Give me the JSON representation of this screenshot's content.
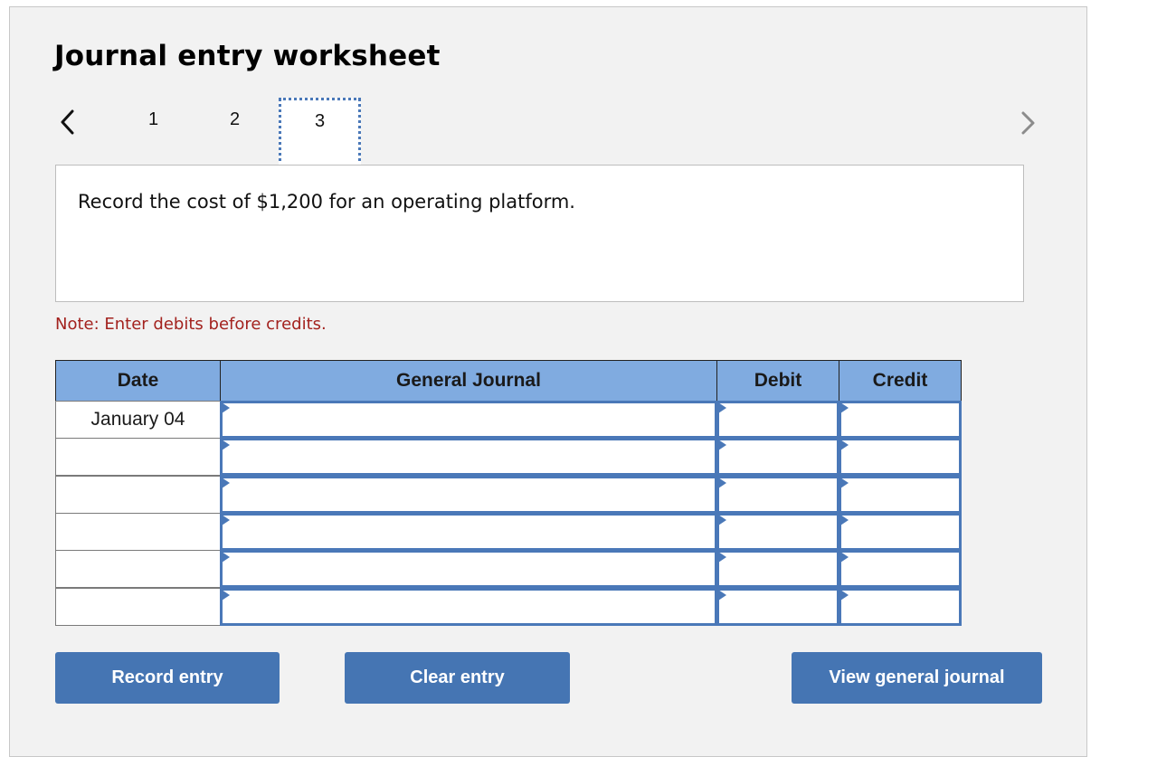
{
  "worksheet": {
    "title": "Journal entry worksheet",
    "nav": {
      "prev_icon": "chevron-left-icon",
      "next_icon": "chevron-right-icon",
      "steps": [
        "1",
        "2",
        "3"
      ],
      "active_step": "3"
    },
    "prompt": "Record the cost of $1,200 for an operating platform.",
    "note": "Note: Enter debits before credits."
  },
  "journal": {
    "headers": {
      "date": "Date",
      "general_journal": "General Journal",
      "debit": "Debit",
      "credit": "Credit"
    },
    "rows": [
      {
        "date": "January 04",
        "account": "",
        "debit": "",
        "credit": ""
      },
      {
        "date": "",
        "account": "",
        "debit": "",
        "credit": ""
      },
      {
        "date": "",
        "account": "",
        "debit": "",
        "credit": ""
      },
      {
        "date": "",
        "account": "",
        "debit": "",
        "credit": ""
      },
      {
        "date": "",
        "account": "",
        "debit": "",
        "credit": ""
      },
      {
        "date": "",
        "account": "",
        "debit": "",
        "credit": ""
      }
    ]
  },
  "buttons": {
    "record": "Record entry",
    "clear": "Clear entry",
    "view": "View general journal"
  },
  "colors": {
    "header_bg": "#80abe0",
    "input_border": "#4a78b8",
    "button_bg": "#4575b3",
    "note_text": "#a3221e"
  }
}
